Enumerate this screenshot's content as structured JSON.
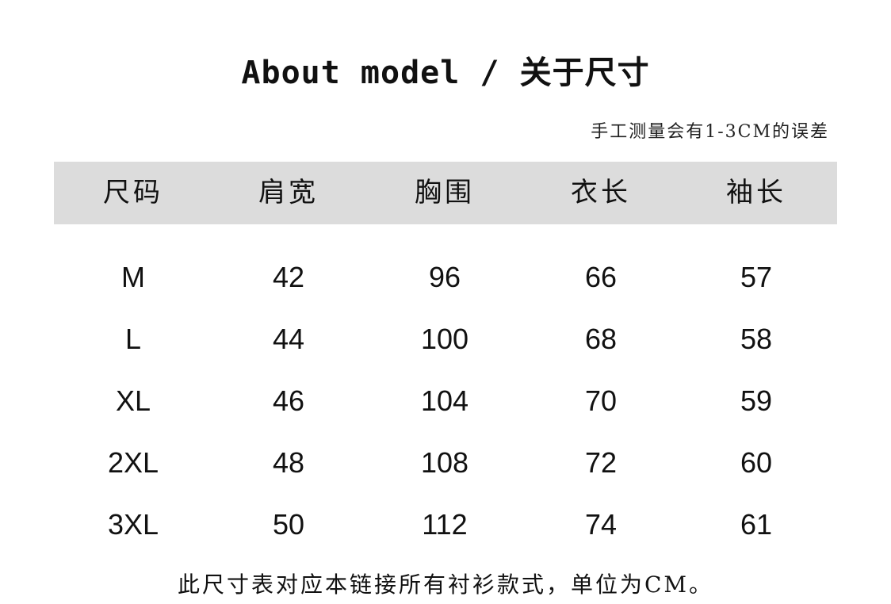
{
  "title": "About model / 关于尺寸",
  "note": "手工测量会有1-3CM的误差",
  "table": {
    "headers": [
      "尺码",
      "肩宽",
      "胸围",
      "衣长",
      "袖长"
    ],
    "rows": [
      [
        "M",
        "42",
        "96",
        "66",
        "57"
      ],
      [
        "L",
        "44",
        "100",
        "68",
        "58"
      ],
      [
        "XL",
        "46",
        "104",
        "70",
        "59"
      ],
      [
        "2XL",
        "48",
        "108",
        "72",
        "60"
      ],
      [
        "3XL",
        "50",
        "112",
        "74",
        "61"
      ]
    ]
  },
  "footer": "此尺寸表对应本链接所有衬衫款式，单位为CM。",
  "colors": {
    "header_bg": "#dcdcdc",
    "text": "#111111",
    "background": "#ffffff"
  }
}
